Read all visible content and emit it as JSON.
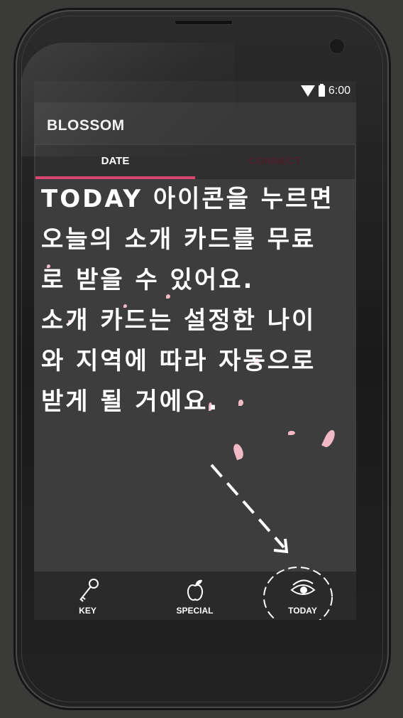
{
  "status": {
    "time": "6:00",
    "icons": [
      "wifi-icon",
      "battery-icon"
    ]
  },
  "app": {
    "title": "BLOSSOM"
  },
  "tabs": [
    {
      "label": "DATE",
      "selected": true
    },
    {
      "label": "CONNECT",
      "selected": false
    }
  ],
  "message": {
    "lines": [
      "TODAY 아이콘을 누르면",
      "오늘의 소개 카드를 무료",
      "로 받을 수 있어요.",
      "소개 카드는 설정한 나이",
      "와 지역에 따라 자동으로",
      "받게 될 거에요."
    ]
  },
  "bottom_nav": [
    {
      "label": "KEY",
      "icon": "key-icon"
    },
    {
      "label": "SPECIAL",
      "icon": "apple-icon"
    },
    {
      "label": "TODAY",
      "icon": "eye-icon",
      "highlighted": true
    }
  ],
  "colors": {
    "accent": "#d9466d",
    "background": "#3d3d3d",
    "petal": "#f1b8c6"
  }
}
